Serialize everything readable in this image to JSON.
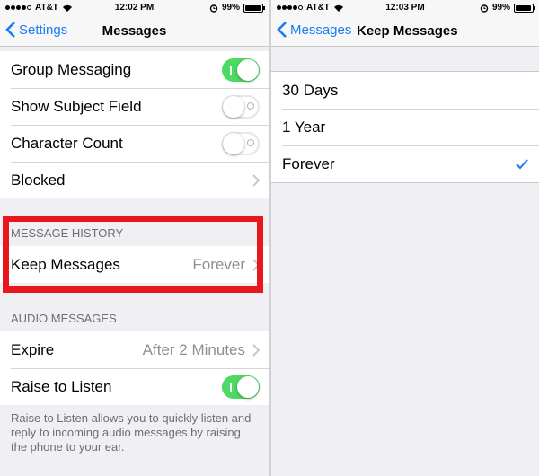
{
  "left": {
    "status": {
      "carrier": "AT&T",
      "time": "12:02 PM",
      "battery": "99%"
    },
    "nav": {
      "back": "Settings",
      "title": "Messages"
    },
    "rows": [
      {
        "label": "Group Messaging",
        "toggle": "on"
      },
      {
        "label": "Show Subject Field",
        "toggle": "off"
      },
      {
        "label": "Character Count",
        "toggle": "off"
      },
      {
        "label": "Blocked"
      }
    ],
    "history": {
      "header": "MESSAGE HISTORY",
      "label": "Keep Messages",
      "value": "Forever"
    },
    "audio": {
      "header": "AUDIO MESSAGES",
      "expire_label": "Expire",
      "expire_value": "After 2 Minutes",
      "raise_label": "Raise to Listen",
      "raise_toggle": "on",
      "footer": "Raise to Listen allows you to quickly listen and reply to incoming audio messages by raising the phone to your ear."
    }
  },
  "right": {
    "status": {
      "carrier": "AT&T",
      "time": "12:03 PM",
      "battery": "99%"
    },
    "nav": {
      "back": "Messages",
      "title": "Keep Messages"
    },
    "options": [
      {
        "label": "30 Days",
        "selected": false
      },
      {
        "label": "1 Year",
        "selected": false
      },
      {
        "label": "Forever",
        "selected": true
      }
    ]
  },
  "colors": {
    "accent": "#1a7cf5",
    "toggle_on": "#4cd964",
    "highlight": "#e8171c"
  },
  "icons": [
    "back-chevron-icon",
    "chevron-right-icon",
    "checkmark-icon",
    "wifi-icon",
    "alarm-icon",
    "battery-icon"
  ]
}
